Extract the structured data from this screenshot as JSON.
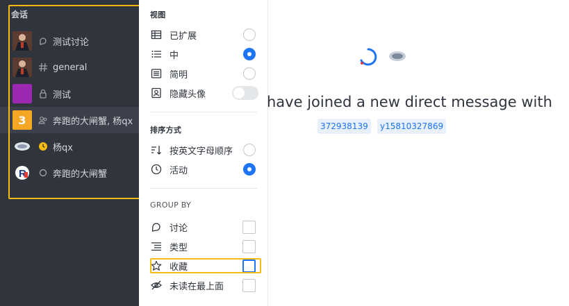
{
  "sidebar": {
    "header": "会话",
    "rooms": [
      {
        "name": "测试讨论",
        "type": "discussion-icon",
        "avatar": "photo"
      },
      {
        "name": "general",
        "type": "hash-icon",
        "avatar": "photo"
      },
      {
        "name": "测试",
        "type": "lock-icon",
        "avatar": "purple"
      },
      {
        "name": "奔跑的大闸蟹, 杨qx",
        "type": "group-icon",
        "avatar_text": "3",
        "active": true
      },
      {
        "name": "杨qx",
        "type": "away-status-icon",
        "avatar": "blur"
      },
      {
        "name": "奔跑的大闸蟹",
        "type": "offline-status-icon",
        "avatar": "logo"
      }
    ]
  },
  "menu": {
    "view_title": "视图",
    "view_items": [
      {
        "label": "已扩展",
        "icon": "table-icon",
        "selected": false
      },
      {
        "label": "中",
        "icon": "list-icon",
        "selected": true
      },
      {
        "label": "简明",
        "icon": "list-compact-icon",
        "selected": false
      },
      {
        "label": "隐藏头像",
        "icon": "avatar-icon",
        "toggle": false
      }
    ],
    "sort_title": "排序方式",
    "sort_items": [
      {
        "label": "按英文字母顺序",
        "icon": "sort-az-icon",
        "selected": false
      },
      {
        "label": "活动",
        "icon": "clock-icon",
        "selected": true
      }
    ],
    "group_title": "GROUP BY",
    "group_items": [
      {
        "label": "讨论",
        "icon": "discussion-icon",
        "checked": false
      },
      {
        "label": "类型",
        "icon": "type-icon",
        "checked": false
      },
      {
        "label": "收藏",
        "icon": "star-icon",
        "checked": false
      },
      {
        "label": "未读在最上面",
        "icon": "eye-off-icon",
        "checked": false
      }
    ]
  },
  "main": {
    "joined_text": "have joined a new direct message with",
    "users": [
      "372938139",
      "y15810327869"
    ]
  },
  "colors": {
    "accent": "#1d74f5",
    "highlight": "#f5bb12",
    "sidebar_bg": "#2f343d"
  }
}
